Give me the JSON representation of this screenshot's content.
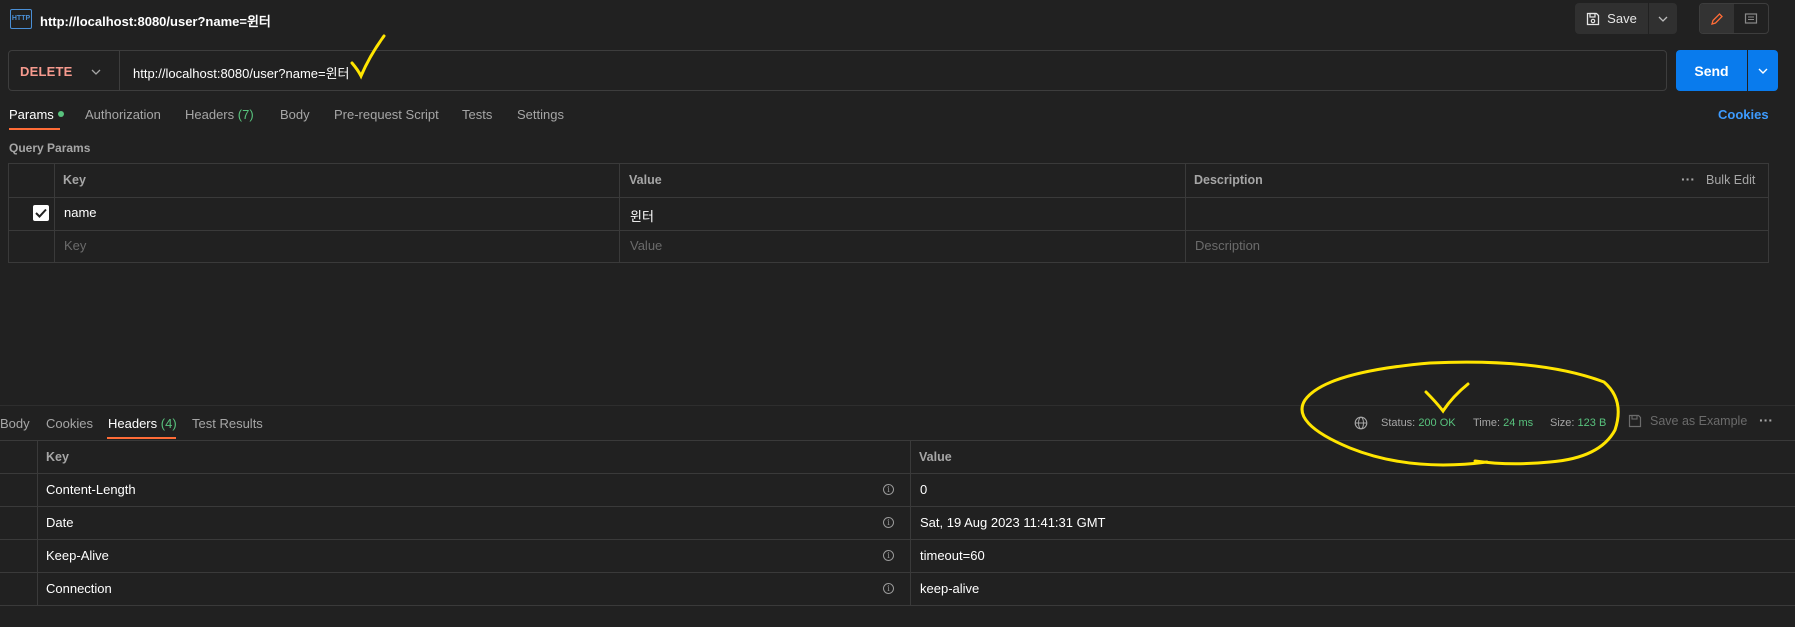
{
  "tab": {
    "title": "http://localhost:8080/user?name=윈터",
    "icon": "http-icon",
    "icon_text": "HTTP"
  },
  "toolbar": {
    "save_label": "Save"
  },
  "request": {
    "method": "DELETE",
    "url": "http://localhost:8080/user?name=윈터",
    "send_label": "Send"
  },
  "request_tabs": [
    {
      "label": "Params",
      "active": true
    },
    {
      "label": "Authorization"
    },
    {
      "label": "Headers",
      "count": "(7)"
    },
    {
      "label": "Body"
    },
    {
      "label": "Pre-request Script"
    },
    {
      "label": "Tests"
    },
    {
      "label": "Settings"
    }
  ],
  "cookies_link": "Cookies",
  "query_params": {
    "section_label": "Query Params",
    "headers": {
      "key": "Key",
      "value": "Value",
      "description": "Description"
    },
    "bulk_edit": "Bulk Edit",
    "rows": [
      {
        "checked": true,
        "key": "name",
        "value": "윈터",
        "description": ""
      }
    ],
    "placeholders": {
      "key": "Key",
      "value": "Value",
      "description": "Description"
    }
  },
  "response_tabs": [
    {
      "label": "Body"
    },
    {
      "label": "Cookies"
    },
    {
      "label": "Headers",
      "count": "(4)",
      "active": true
    },
    {
      "label": "Test Results"
    }
  ],
  "response_meta": {
    "status_label": "Status:",
    "status": "200 OK",
    "time_label": "Time:",
    "time": "24 ms",
    "size_label": "Size:",
    "size": "123 B",
    "save_example": "Save as Example"
  },
  "response_headers": {
    "columns": {
      "key": "Key",
      "value": "Value"
    },
    "rows": [
      {
        "key": "Content-Length",
        "value": "0"
      },
      {
        "key": "Date",
        "value": "Sat, 19 Aug 2023 11:41:31 GMT"
      },
      {
        "key": "Keep-Alive",
        "value": "timeout=60"
      },
      {
        "key": "Connection",
        "value": "keep-alive"
      }
    ]
  },
  "colors": {
    "background": "#212121",
    "accent_orange": "#ff6c37",
    "send_blue": "#097bed",
    "method_delete": "#f79a8e",
    "status_green": "#58c27d",
    "annotation_yellow": "#ffe500"
  }
}
